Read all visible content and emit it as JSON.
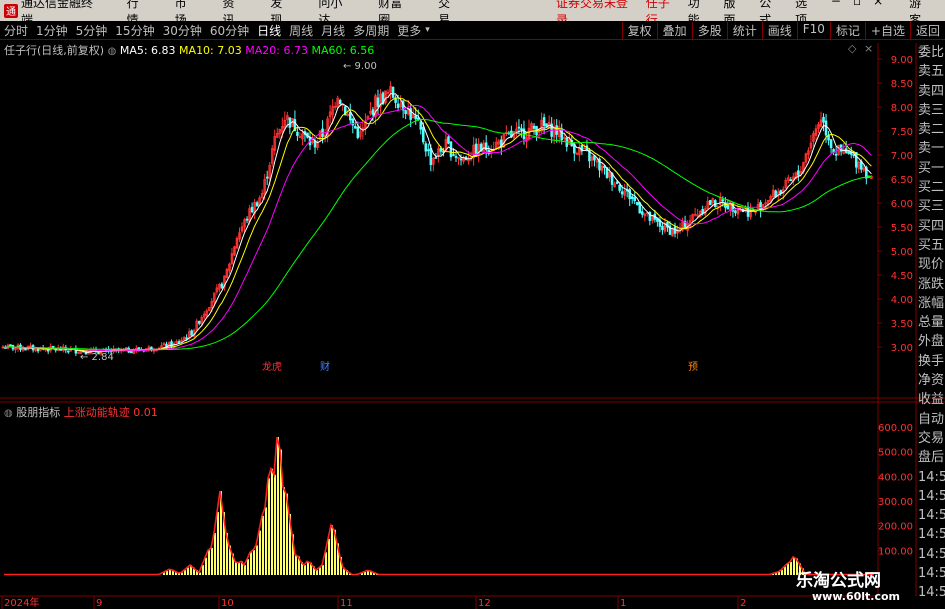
{
  "menu": {
    "app_title": "通达信金融终端",
    "items": [
      "行情",
      "市场",
      "资讯",
      "发现",
      "问小达",
      "财富圈",
      "交易"
    ],
    "warning": "证券交易未登录",
    "stock_name": "任子行",
    "right_items": [
      "功能",
      "版面",
      "公式",
      "选项"
    ],
    "guest": "游客"
  },
  "toolbar": {
    "timeframes": [
      "分时",
      "1分钟",
      "5分钟",
      "15分钟",
      "30分钟",
      "60分钟",
      "日线",
      "周线",
      "月线",
      "多周期",
      "更多"
    ],
    "active": "日线",
    "tools": [
      "复权",
      "叠加",
      "多股",
      "统计",
      "画线",
      "F10",
      "标记",
      "+自选",
      "返回"
    ]
  },
  "legend_main": {
    "title": "任子行(日线,前复权)",
    "ma5": "MA5: 6.83",
    "ma10": "MA10: 7.03",
    "ma20": "MA20: 6.73",
    "ma60": "MA60: 6.56"
  },
  "legend_sub": {
    "title": "股朋指标",
    "name": "上涨动能轨迹",
    "value": "0.01"
  },
  "price_axis": [
    "9.00",
    "8.50",
    "8.00",
    "7.50",
    "7.00",
    "6.50",
    "6.00",
    "5.50",
    "5.00",
    "4.50",
    "4.00",
    "3.50",
    "3.00"
  ],
  "indicator_axis": [
    "600.00",
    "500.00",
    "400.00",
    "300.00",
    "200.00",
    "100.00"
  ],
  "date_axis": [
    "2024年",
    "9",
    "10",
    "11",
    "12",
    "1",
    "2"
  ],
  "annotations": {
    "high": "9.00",
    "low": "2.84",
    "markers": [
      "龙虎",
      "财",
      "预"
    ]
  },
  "right_panel": [
    "委比",
    "卖五",
    "卖四",
    "卖三",
    "卖二",
    "卖一",
    "买一",
    "买二",
    "买三",
    "买四",
    "买五",
    "现价",
    "涨跌",
    "涨幅",
    "总量",
    "外盘",
    "换手",
    "净资",
    "收益",
    "自动",
    "交易",
    "盘后",
    "14:56",
    "14:56",
    "14:56",
    "14:56",
    "14:56",
    "14:56",
    "14:56",
    "14:56"
  ],
  "watermark": {
    "title": "乐淘公式网",
    "url": "www.60lt.com"
  },
  "colors": {
    "up": "#ff3232",
    "down": "#54ffff",
    "ma5": "#ffffff",
    "ma10": "#ffff00",
    "ma20": "#ff00ff",
    "ma60": "#00ff00",
    "grid": "#800000"
  }
}
